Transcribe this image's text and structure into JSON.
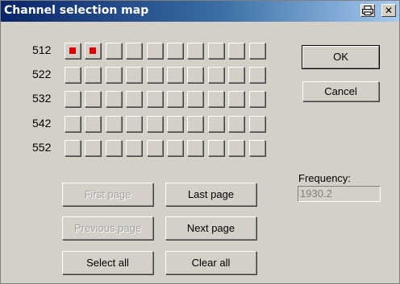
{
  "window": {
    "title": "Channel selection map",
    "printer_icon": "printer-icon",
    "close_label": "✕"
  },
  "grid": {
    "rows": [
      "512",
      "522",
      "532",
      "542",
      "552"
    ],
    "columns": 10,
    "selected": [
      [
        0,
        0
      ],
      [
        0,
        1
      ]
    ],
    "selected_color": "#e00000"
  },
  "buttons": {
    "ok": "OK",
    "cancel": "Cancel",
    "first_page": "First page",
    "last_page": "Last page",
    "previous_page": "Previous page",
    "next_page": "Next page",
    "select_all": "Select all",
    "clear_all": "Clear all"
  },
  "frequency": {
    "label": "Frequency:",
    "value": "1930.2"
  }
}
